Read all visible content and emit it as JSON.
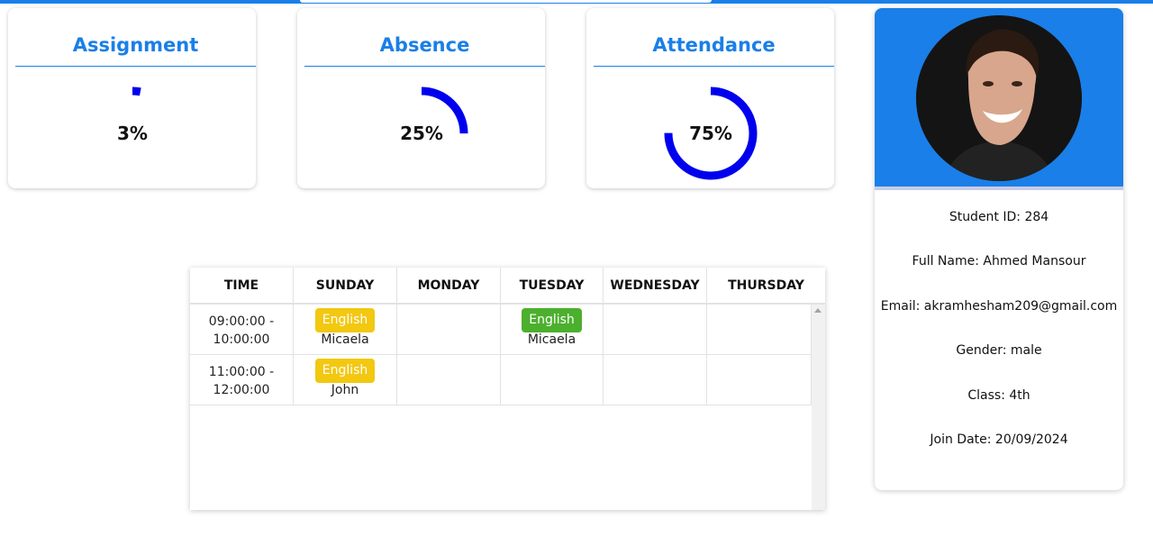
{
  "stats": [
    {
      "title": "Assignment",
      "value_text": "3%",
      "percent": 3
    },
    {
      "title": "Absence",
      "value_text": "25%",
      "percent": 25
    },
    {
      "title": "Attendance",
      "value_text": "75%",
      "percent": 75
    }
  ],
  "schedule": {
    "headers": [
      "TIME",
      "SUNDAY",
      "MONDAY",
      "TUESDAY",
      "WEDNESDAY",
      "THURSDAY"
    ],
    "rows": [
      {
        "time_start": "09:00:00 -",
        "time_end": "10:00:00",
        "sunday": {
          "subject": "English",
          "teacher": "Micaela",
          "color": "#f2c811"
        },
        "tuesday": {
          "subject": "English",
          "teacher": "Micaela",
          "color": "#4caf2e"
        }
      },
      {
        "time_start": "11:00:00 -",
        "time_end": "12:00:00",
        "sunday": {
          "subject": "English",
          "teacher": "John",
          "color": "#f2c811"
        }
      }
    ]
  },
  "profile": {
    "student_id": "Student ID: 284",
    "full_name": "Full Name: Ahmed Mansour",
    "email": "Email: akramhesham209@gmail.com",
    "gender": "Gender: male",
    "class": "Class: 4th",
    "join_date": "Join Date: 20/09/2024"
  },
  "colors": {
    "accent": "#1a7fe8",
    "ring": "#0000ee",
    "badge_yellow": "#f2c811",
    "badge_green": "#4caf2e"
  }
}
